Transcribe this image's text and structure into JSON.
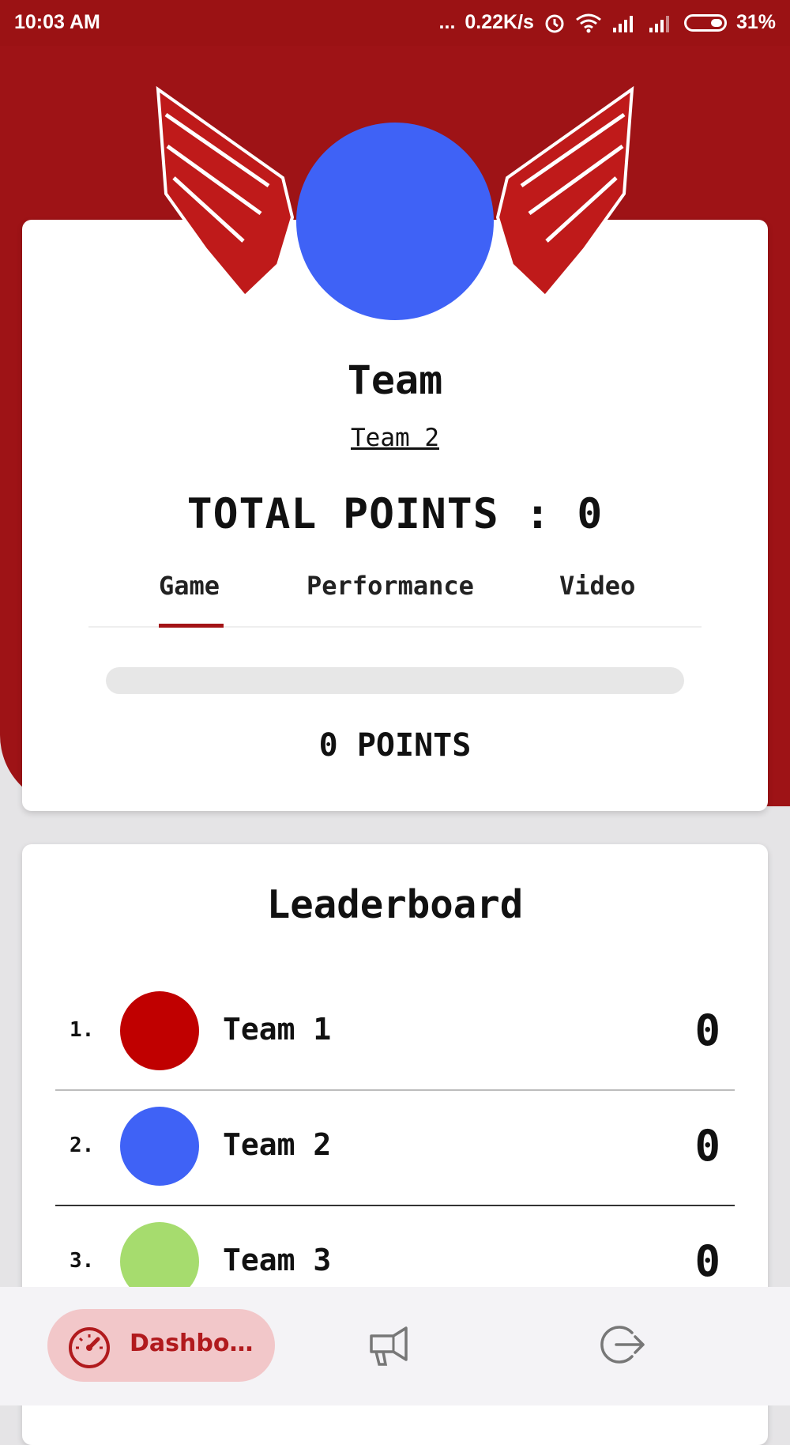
{
  "status_bar": {
    "time": "10:03 AM",
    "more": "...",
    "network_speed": "0.22K/s",
    "battery": "31%"
  },
  "team_card": {
    "title": "Team",
    "team_name": "Team 2",
    "total_points_label": "TOTAL POINTS : 0",
    "tabs": [
      {
        "label": "Game",
        "active": true
      },
      {
        "label": "Performance",
        "active": false
      },
      {
        "label": "Video",
        "active": false
      }
    ],
    "progress_value": 0,
    "points_text": "0 POINTS",
    "team_color": "#3f62f6"
  },
  "leaderboard": {
    "title": "Leaderboard",
    "rows": [
      {
        "rank": "1.",
        "name": "Team 1",
        "score": "0",
        "color": "#c00000"
      },
      {
        "rank": "2.",
        "name": "Team 2",
        "score": "0",
        "color": "#3f62f6"
      },
      {
        "rank": "3.",
        "name": "Team 3",
        "score": "0",
        "color": "#a6dc6e"
      }
    ]
  },
  "bottom_nav": {
    "items": [
      {
        "label": "Dashboard",
        "icon": "speedometer-icon",
        "active": true
      },
      {
        "icon": "megaphone-icon",
        "active": false
      },
      {
        "icon": "logout-icon",
        "active": false
      }
    ]
  },
  "colors": {
    "brand_red": "#9e1316",
    "accent_red": "#a31316",
    "wing_red": "#bf1a1a"
  }
}
